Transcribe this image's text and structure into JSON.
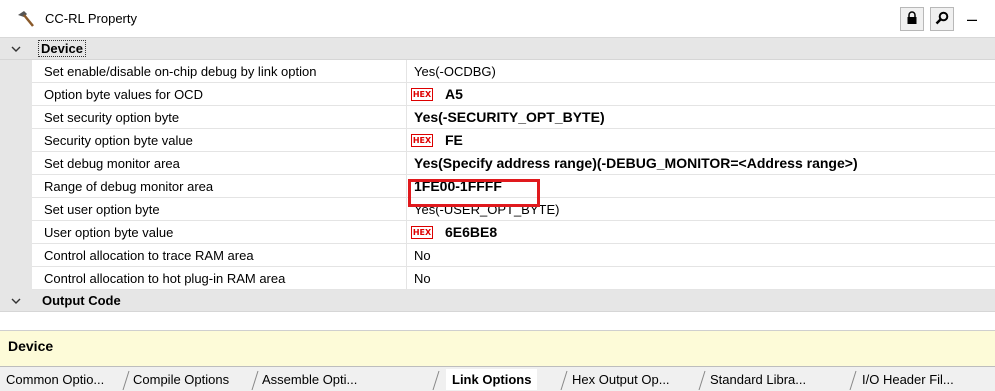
{
  "panel": {
    "title": "CC-RL Property",
    "icons": [
      "hammer-icon",
      "lock-icon",
      "search-icon",
      "minimize-icon"
    ],
    "minimize_glyph": "–"
  },
  "categories": {
    "device": {
      "label": "Device"
    },
    "output_code": {
      "label": "Output Code"
    }
  },
  "hex_badge_text": "HEX",
  "properties": [
    {
      "name": "Set enable/disable on-chip debug by link option",
      "value": "Yes(-OCDBG)"
    },
    {
      "name": "Option byte values for OCD",
      "value": "A5"
    },
    {
      "name": "Set security option byte",
      "value": "Yes(-SECURITY_OPT_BYTE)"
    },
    {
      "name": "Security option byte value",
      "value": "FE"
    },
    {
      "name": "Set debug monitor area",
      "value": "Yes(Specify address range)(-DEBUG_MONITOR=<Address range>)"
    },
    {
      "name": "Range of debug monitor area",
      "value": "1FE00-1FFFF"
    },
    {
      "name": "Set user option byte",
      "value": "Yes(-USER_OPT_BYTE)"
    },
    {
      "name": "User option byte value",
      "value": "6E6BE8"
    },
    {
      "name": "Control allocation to trace RAM area",
      "value": "No"
    },
    {
      "name": "Control allocation to hot plug-in RAM area",
      "value": "No"
    }
  ],
  "description": {
    "title": "Device"
  },
  "tabs": [
    {
      "label": "Common Optio..."
    },
    {
      "label": "Compile Options"
    },
    {
      "label": "Assemble Opti..."
    },
    {
      "label": "Link Options"
    },
    {
      "label": "Hex Output Op..."
    },
    {
      "label": "Standard Libra..."
    },
    {
      "label": "I/O Header Fil..."
    }
  ],
  "colors": {
    "highlight": "#e0191d",
    "hex_badge": "#dd0000",
    "description_bg": "#fdfbd8",
    "category_bg": "#e6e6e6"
  }
}
